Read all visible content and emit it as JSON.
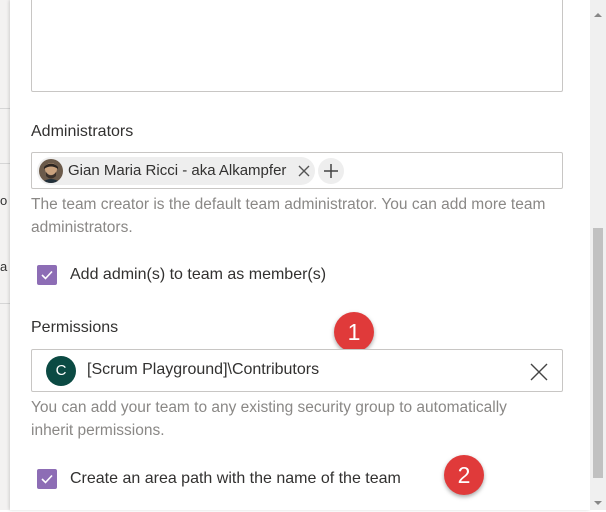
{
  "administrators": {
    "label": "Administrators",
    "members": [
      {
        "name": "Gian Maria Ricci - aka Alkampfer"
      }
    ],
    "help": "The team creator is the default team administrator. You can add more team administrators.",
    "add_as_member": {
      "label": "Add admin(s) to team as member(s)",
      "checked": true
    }
  },
  "permissions": {
    "label": "Permissions",
    "group": {
      "initial": "C",
      "name": "[Scrum Playground]\\Contributors"
    },
    "help": "You can add your team to any existing security group to automatically inherit permissions."
  },
  "area_path": {
    "label": "Create an area path with the name of the team",
    "checked": true
  },
  "annotations": [
    "1",
    "2"
  ],
  "colors": {
    "checkbox": "#8d6db5",
    "group_avatar": "#0b4a43",
    "callout": "#e03a3a"
  },
  "background_page": {
    "fragments": [
      "o",
      "a"
    ]
  }
}
